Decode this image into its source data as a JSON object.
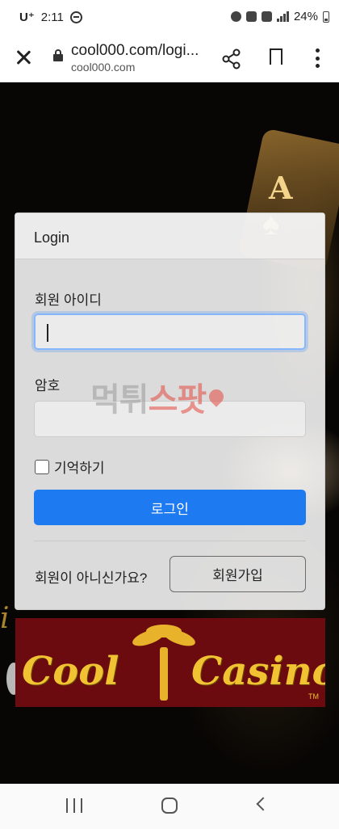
{
  "status_bar": {
    "carrier": "U⁺",
    "time": "2:11",
    "battery": "24%"
  },
  "browser": {
    "url_main": "cool000.com/logi...",
    "url_domain": "cool000.com"
  },
  "login": {
    "header_title": "Login",
    "id_label": "회원 아이디",
    "id_value": "",
    "password_label": "암호",
    "password_value": "",
    "remember_label": "기억하기",
    "login_button": "로그인",
    "signup_prompt": "회원이 아니신가요?",
    "signup_button": "회원가입"
  },
  "watermark": {
    "part1": "먹튀",
    "part2": "스팟"
  },
  "banner": {
    "word1": "Cool",
    "word2": "Casino",
    "trademark": "TM"
  },
  "background": {
    "ace_letter": "A",
    "ace_suit": "♠"
  }
}
